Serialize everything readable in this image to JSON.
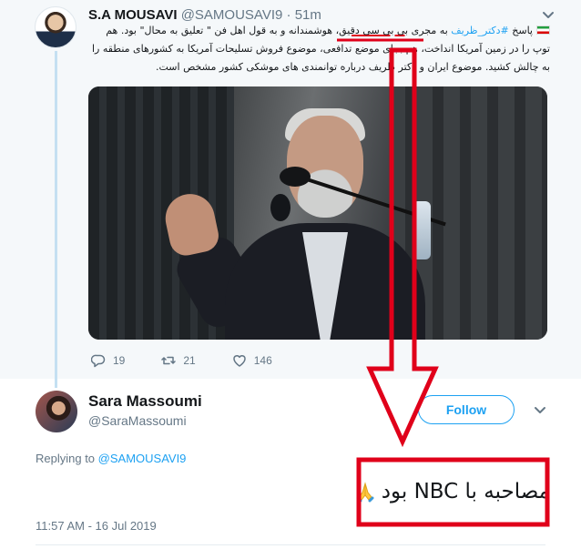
{
  "parent_tweet": {
    "author_name": "S.A MOUSAVI",
    "author_handle": "@SAMOUSAVI9",
    "separator": "·",
    "time": "51m",
    "text_parts": {
      "prefix": "پاسخ ",
      "hashtag": "#دکتر_ظریف",
      "middle": " به مجری ",
      "highlighted": "بی بی سی دقیق",
      "rest": "، هوشمندانه و به قول اهل فن \" تعلیق به محال\" بود. هم توپ را در زمین آمریکا انداخت، هم بجای موضع تدافعی، موضوع فروش تسلیحات آمریکا به کشورهای منطقه را به چالش کشید. موضوع ایران و دکتر ظریف درباره توانمندی های موشکی کشور مشخص است."
    },
    "stats": {
      "replies": "19",
      "retweets": "21",
      "likes": "146"
    }
  },
  "reply_tweet": {
    "author_name": "Sara Massoumi",
    "author_handle": "@SaraMassoumi",
    "follow_label": "Follow",
    "replying_prefix": "Replying to ",
    "replying_to": "@SAMOUSAVI9",
    "text": "مصاحبه با NBC بود",
    "emoji": "folded-hands",
    "timestamp": "11:57 AM - 16 Jul 2019"
  },
  "colors": {
    "accent": "#1da1f2",
    "muted": "#657786",
    "annotation": "#e0001a",
    "parent_bg": "#f5f8fa"
  },
  "icons": [
    "chevron-down-icon",
    "reply-icon",
    "retweet-icon",
    "like-icon",
    "iran-flag-icon",
    "folded-hands-icon"
  ]
}
